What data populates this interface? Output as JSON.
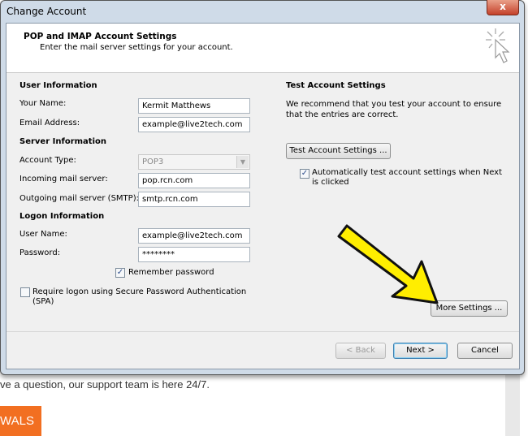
{
  "window": {
    "title": "Change Account",
    "close_label": "x"
  },
  "header": {
    "title": "POP and IMAP Account Settings",
    "subtitle": "Enter the mail server settings for your account."
  },
  "user_info": {
    "heading": "User Information",
    "name_label": "Your Name:",
    "name_value": "Kermit Matthews",
    "email_label": "Email Address:",
    "email_value": "example@live2tech.com"
  },
  "server_info": {
    "heading": "Server Information",
    "type_label": "Account Type:",
    "type_value": "POP3",
    "incoming_label": "Incoming mail server:",
    "incoming_value": "pop.rcn.com",
    "outgoing_label": "Outgoing mail server (SMTP):",
    "outgoing_value": "smtp.rcn.com"
  },
  "logon_info": {
    "heading": "Logon Information",
    "user_label": "User Name:",
    "user_value": "example@live2tech.com",
    "password_label": "Password:",
    "password_value": "********",
    "remember_label": "Remember password",
    "remember_checked": true,
    "spa_label": "Require logon using Secure Password Authentication (SPA)",
    "spa_checked": false
  },
  "test": {
    "heading": "Test Account Settings",
    "description": "We recommend that you test your account to ensure that the entries are correct.",
    "button": "Test Account Settings ...",
    "auto_label": "Automatically test account settings when Next is clicked",
    "auto_checked": true
  },
  "more_settings": "More Settings ...",
  "footer": {
    "back": "< Back",
    "next": "Next >",
    "cancel": "Cancel"
  },
  "background_page": {
    "text": "ve a question, our support team is here 24/7.",
    "button": "WALS"
  },
  "colors": {
    "annotation_arrow": "#ffee00",
    "orange_button": "#f26f21"
  }
}
